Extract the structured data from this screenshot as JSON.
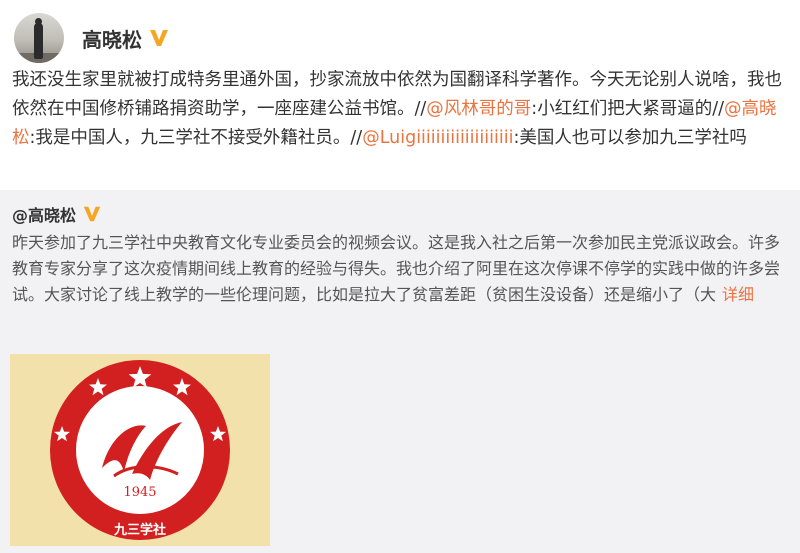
{
  "post": {
    "author": "高晓松",
    "verified_icon": "v-verified-badge-icon",
    "text_segments": [
      {
        "type": "text",
        "value": "我还没生家里就被打成特务里通外国，抄家流放中依然为国翻译科学著作。今天无论别人说啥，我也依然在中国修桥铺路捐资助学，一座座建公益书馆。//"
      },
      {
        "type": "mention",
        "value": "@风林哥的哥"
      },
      {
        "type": "text",
        "value": ":小红红们把大紧哥逼的//"
      },
      {
        "type": "mention",
        "value": "@高晓松"
      },
      {
        "type": "text",
        "value": ":我是中国人，九三学社不接受外籍社员。//"
      },
      {
        "type": "mention",
        "value": "@Luigiiiiiiiiiiiiiiiiiiii"
      },
      {
        "type": "text",
        "value": ":美国人也可以参加九三学社吗"
      }
    ]
  },
  "quote": {
    "author": "@高晓松",
    "verified_icon": "v-verified-badge-icon",
    "text": "昨天参加了九三学社中央教育文化专业委员会的视频会议。这是我入社之后第一次参加民主党派议政会。许多教育专家分享了这次疫情期间线上教育的经验与得失。我也介绍了阿里在这次停课不停学的实践中做的许多尝试。大家讨论了线上教学的一些伦理问题，比如是拉大了贫富差距（贫困生没设备）还是缩小了（大",
    "more_label": "详细",
    "image": {
      "logo_year": "1945",
      "logo_name": "九三学社"
    }
  },
  "colors": {
    "accent": "#eb7340",
    "badge": "#f5a623",
    "quote_bg": "#f2f2f5",
    "logo_red": "#d21f1f",
    "image_bg": "#f3e1ab"
  }
}
